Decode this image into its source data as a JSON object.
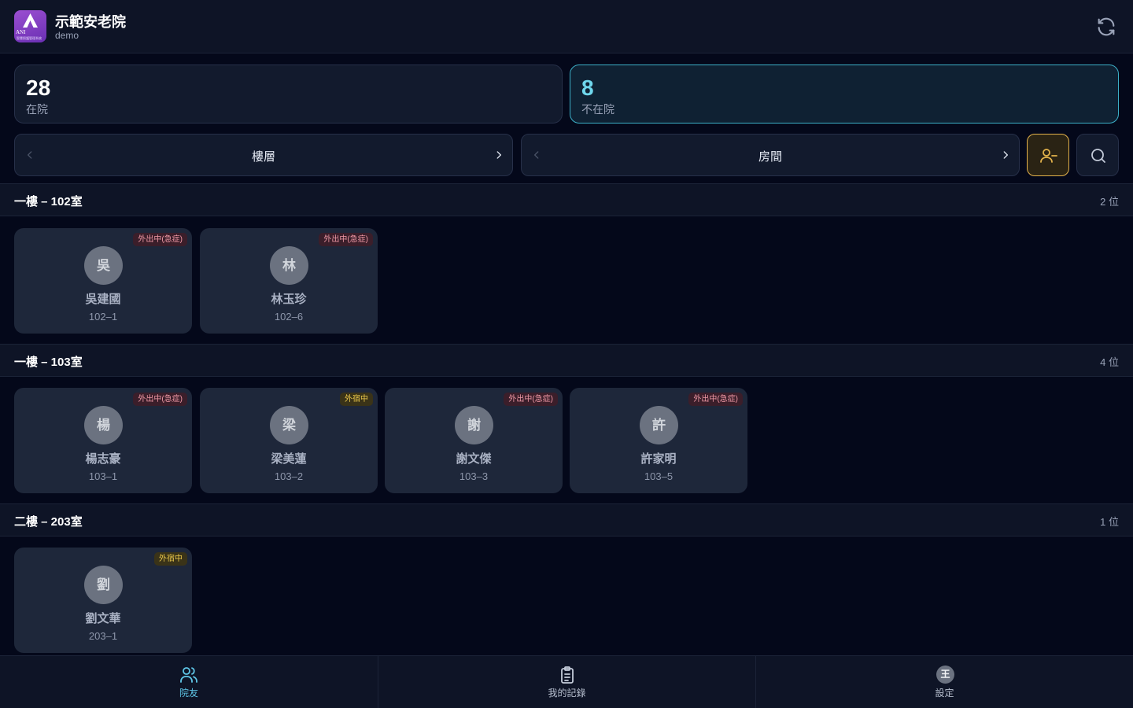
{
  "header": {
    "logo_text": "ANI",
    "logo_sub": "智慧照護管理系統",
    "title": "示範安老院",
    "subtitle": "demo"
  },
  "stats": {
    "present": {
      "count": "28",
      "label": "在院"
    },
    "absent": {
      "count": "8",
      "label": "不在院"
    }
  },
  "filters": {
    "floor_label": "樓層",
    "room_label": "房間"
  },
  "sections": [
    {
      "title": "一樓 – 102室",
      "count": "2 位",
      "residents": [
        {
          "avatar": "吳",
          "name": "吳建國",
          "bed": "102–1",
          "status": "外出中(急症)"
        },
        {
          "avatar": "林",
          "name": "林玉珍",
          "bed": "102–6",
          "status": "外出中(急症)"
        }
      ]
    },
    {
      "title": "一樓 – 103室",
      "count": "4 位",
      "residents": [
        {
          "avatar": "楊",
          "name": "楊志豪",
          "bed": "103–1",
          "status": "外出中(急症)"
        },
        {
          "avatar": "梁",
          "name": "梁美蓮",
          "bed": "103–2",
          "status": "外宿中"
        },
        {
          "avatar": "謝",
          "name": "謝文傑",
          "bed": "103–3",
          "status": "外出中(急症)"
        },
        {
          "avatar": "許",
          "name": "許家明",
          "bed": "103–5",
          "status": "外出中(急症)"
        }
      ]
    },
    {
      "title": "二樓 – 203室",
      "count": "1 位",
      "residents": [
        {
          "avatar": "劉",
          "name": "劉文華",
          "bed": "203–1",
          "status": "外宿中"
        }
      ]
    }
  ],
  "nav": {
    "residents": "院友",
    "records": "我的記錄",
    "settings": "設定",
    "settings_avatar": "王"
  },
  "colors": {
    "accent": "#5fc7e8",
    "warning": "#e2b24b",
    "emergency_badge": "#f19aa7",
    "stay_badge": "#ecc94b"
  }
}
